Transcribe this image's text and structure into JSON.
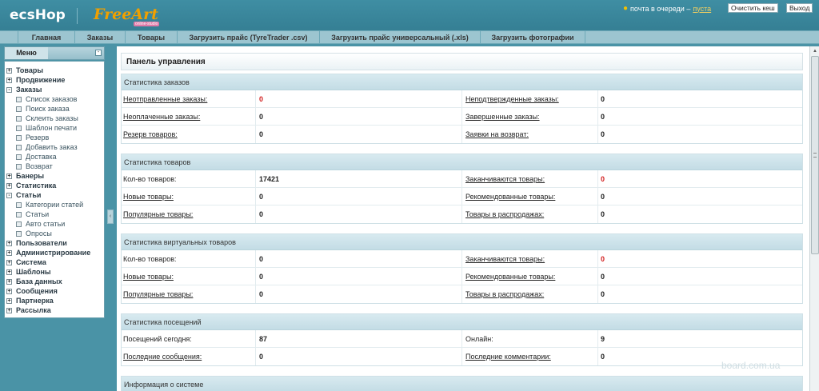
{
  "header": {
    "logo_primary": "ecsHop",
    "logo_secondary": "FreeArt",
    "logo_secondary_tag": "online-studio",
    "queue_text": "почта в очереди –",
    "queue_link": "пуста",
    "clear_cache": "Очистить кеш",
    "logout": "Выход"
  },
  "tabs": [
    {
      "label": "Главная"
    },
    {
      "label": "Заказы"
    },
    {
      "label": "Товары"
    },
    {
      "label": "Загрузить прайс (TyreTrader .csv)"
    },
    {
      "label": "Загрузить прайс универсальный (.xls)"
    },
    {
      "label": "Загрузить фотографии"
    }
  ],
  "menu": {
    "title": "Меню",
    "minimize": "-",
    "items": [
      {
        "label": "Товары",
        "sub": false,
        "box": "+"
      },
      {
        "label": "Продвижение",
        "sub": false,
        "box": "+"
      },
      {
        "label": "Заказы",
        "sub": false,
        "box": "-"
      },
      {
        "label": "Список заказов",
        "sub": true,
        "box": ""
      },
      {
        "label": "Поиск заказа",
        "sub": true,
        "box": ""
      },
      {
        "label": "Склеить заказы",
        "sub": true,
        "box": ""
      },
      {
        "label": "Шаблон печати",
        "sub": true,
        "box": ""
      },
      {
        "label": "Резерв",
        "sub": true,
        "box": ""
      },
      {
        "label": "Добавить заказ",
        "sub": true,
        "box": ""
      },
      {
        "label": "Доставка",
        "sub": true,
        "box": ""
      },
      {
        "label": "Возврат",
        "sub": true,
        "box": ""
      },
      {
        "label": "Банеры",
        "sub": false,
        "box": "+"
      },
      {
        "label": "Статистика",
        "sub": false,
        "box": "+"
      },
      {
        "label": "Статьи",
        "sub": false,
        "box": "-"
      },
      {
        "label": "Категории статей",
        "sub": true,
        "box": ""
      },
      {
        "label": "Статьи",
        "sub": true,
        "box": ""
      },
      {
        "label": "Авто статьи",
        "sub": true,
        "box": ""
      },
      {
        "label": "Опросы",
        "sub": true,
        "box": ""
      },
      {
        "label": "Пользователи",
        "sub": false,
        "box": "+"
      },
      {
        "label": "Администрирование",
        "sub": false,
        "box": "+"
      },
      {
        "label": "Система",
        "sub": false,
        "box": "+"
      },
      {
        "label": "Шаблоны",
        "sub": false,
        "box": "+"
      },
      {
        "label": "База данных",
        "sub": false,
        "box": "+"
      },
      {
        "label": "Сообщения",
        "sub": false,
        "box": "+"
      },
      {
        "label": "Партнерка",
        "sub": false,
        "box": "+"
      },
      {
        "label": "Рассылка",
        "sub": false,
        "box": "+"
      }
    ]
  },
  "panel": {
    "title": "Панель управления",
    "sections": [
      {
        "title": "Статистика заказов",
        "rows": [
          {
            "l1": "Неотправленные заказы:",
            "v1": "0",
            "l1_link": true,
            "v1_red": true,
            "l2": "Неподтвержденные заказы:",
            "v2": "0",
            "l2_link": true,
            "v2_red": false
          },
          {
            "l1": "Неоплаченные заказы:",
            "v1": "0",
            "l1_link": true,
            "v1_red": false,
            "l2": "Завершенные заказы:",
            "v2": "0",
            "l2_link": true,
            "v2_red": false
          },
          {
            "l1": "Резерв товаров:",
            "v1": "0",
            "l1_link": true,
            "v1_red": false,
            "l2": "Заявки на возврат:",
            "v2": "0",
            "l2_link": true,
            "v2_red": false
          }
        ]
      },
      {
        "title": "Статистика товаров",
        "rows": [
          {
            "l1": "Кол-во товаров:",
            "v1": "17421",
            "l1_link": false,
            "v1_red": false,
            "l2": "Заканчиваются товары:",
            "v2": "0",
            "l2_link": true,
            "v2_red": true
          },
          {
            "l1": "Новые товары:",
            "v1": "0",
            "l1_link": true,
            "v1_red": false,
            "l2": "Рекомендованные товары:",
            "v2": "0",
            "l2_link": true,
            "v2_red": false
          },
          {
            "l1": "Популярные товары:",
            "v1": "0",
            "l1_link": true,
            "v1_red": false,
            "l2": "Товары в распродажах:",
            "v2": "0",
            "l2_link": true,
            "v2_red": false
          }
        ]
      },
      {
        "title": "Статистика виртуальных товаров",
        "rows": [
          {
            "l1": "Кол-во товаров:",
            "v1": "0",
            "l1_link": false,
            "v1_red": false,
            "l2": "Заканчиваются товары:",
            "v2": "0",
            "l2_link": true,
            "v2_red": true
          },
          {
            "l1": "Новые товары:",
            "v1": "0",
            "l1_link": true,
            "v1_red": false,
            "l2": "Рекомендованные товары:",
            "v2": "0",
            "l2_link": true,
            "v2_red": false
          },
          {
            "l1": "Популярные товары:",
            "v1": "0",
            "l1_link": true,
            "v1_red": false,
            "l2": "Товары в распродажах:",
            "v2": "0",
            "l2_link": true,
            "v2_red": false
          }
        ]
      },
      {
        "title": "Статистика посещений",
        "rows": [
          {
            "l1": "Посещений сегодня:",
            "v1": "87",
            "l1_link": false,
            "v1_red": false,
            "l2": "Онлайн:",
            "v2": "9",
            "l2_link": false,
            "v2_red": false
          },
          {
            "l1": "Последние сообщения:",
            "v1": "0",
            "l1_link": true,
            "v1_red": false,
            "l2": "Последние комментарии:",
            "v2": "0",
            "l2_link": true,
            "v2_red": false
          }
        ]
      },
      {
        "title": "Информация о системе",
        "rows": []
      }
    ]
  },
  "watermark": "board.com.ua",
  "colors": {
    "header_bg": "#3f8ea3",
    "accent_red": "#d21f1f",
    "section_head": "#c3dce5"
  }
}
